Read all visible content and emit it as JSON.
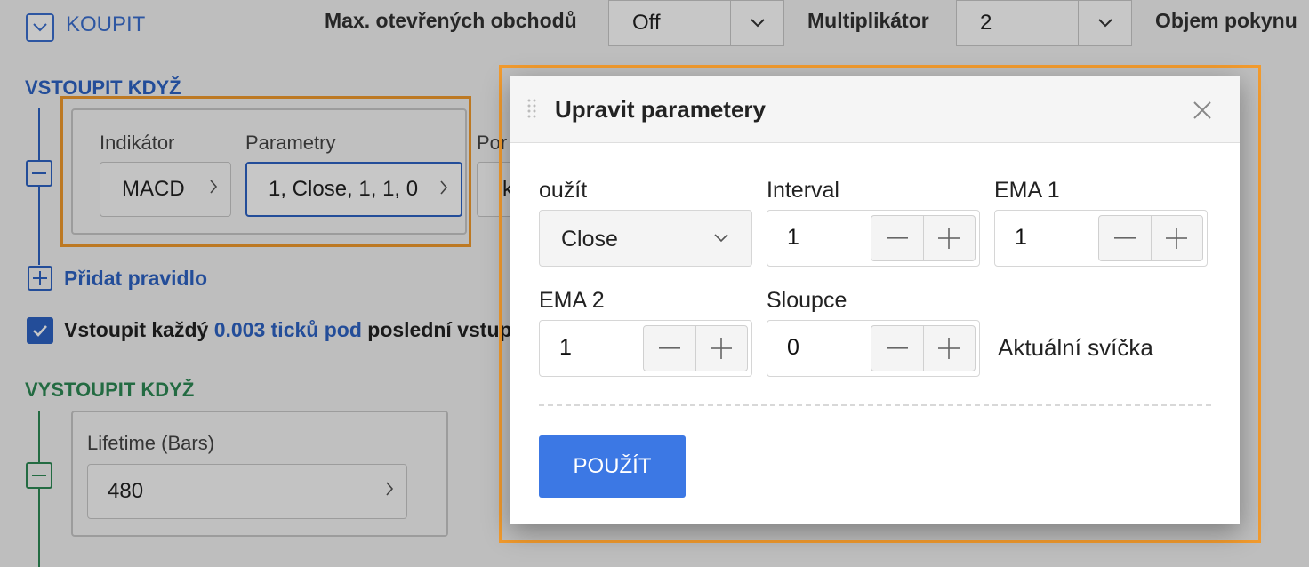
{
  "header": {
    "buy_label": "KOUPIT",
    "max_open_trades_label": "Max. otevřených obchodů",
    "max_open_trades_value": "Off",
    "multiplier_label": "Multiplikátor",
    "multiplier_value": "2",
    "order_volume_label": "Objem pokynu"
  },
  "entry": {
    "section_title": "VSTOUPIT KDYŽ",
    "indicator_label": "Indikátor",
    "indicator_value": "MACD",
    "params_label": "Parametry",
    "params_value": "1, Close, 1, 1, 0",
    "compare_label_partial": "Por",
    "compare_value_partial": "k",
    "add_rule": "Přidat pravidlo",
    "reentry_prefix": "Vstoupit každý",
    "reentry_highlight": "0.003 ticků pod",
    "reentry_suffix": "poslední vstup"
  },
  "exit": {
    "section_title": "VYSTOUPIT KDYŽ",
    "lifetime_label": "Lifetime (Bars)",
    "lifetime_value": "480"
  },
  "modal": {
    "title": "Upravit parametery",
    "fields": {
      "use_label": "oužít",
      "use_value": "Close",
      "interval_label": "Interval",
      "interval_value": "1",
      "ema1_label": "EMA 1",
      "ema1_value": "1",
      "ema2_label": "EMA 2",
      "ema2_value": "1",
      "bars_label": "Sloupce",
      "bars_value": "0",
      "current_candle": "Aktuální svíčka"
    },
    "apply_label": "POUŽÍT"
  },
  "icons": [
    "chevron-down-icon",
    "chevron-right-icon",
    "minus-icon",
    "plus-icon",
    "check-icon",
    "close-icon",
    "drag-handle-icon"
  ],
  "colors": {
    "primary_blue": "#3c78e4",
    "section_blue": "#2e63c4",
    "section_green": "#2e8a55",
    "highlight_orange": "#f29b2e"
  }
}
